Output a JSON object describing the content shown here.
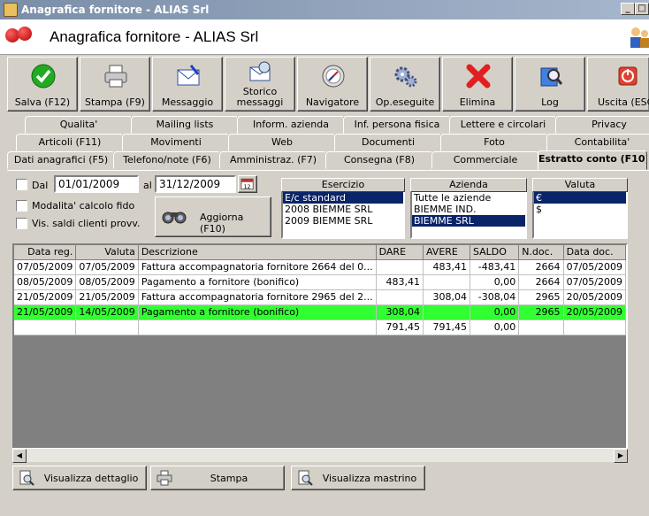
{
  "window": {
    "title": "Anagrafica fornitore - ALIAS Srl",
    "header_title": "Anagrafica fornitore - ALIAS Srl"
  },
  "toolbar": [
    {
      "label": "Salva (F12)",
      "icon": "save-icon"
    },
    {
      "label": "Stampa (F9)",
      "icon": "printer-icon"
    },
    {
      "label": "Messaggio",
      "icon": "message-icon"
    },
    {
      "label": "Storico messaggi",
      "icon": "message-history-icon"
    },
    {
      "label": "Navigatore",
      "icon": "compass-icon"
    },
    {
      "label": "Op.eseguite",
      "icon": "gears-icon"
    },
    {
      "label": "Elimina",
      "icon": "delete-icon"
    },
    {
      "label": "Log",
      "icon": "log-icon"
    },
    {
      "label": "Uscita (ESC)",
      "icon": "exit-icon"
    }
  ],
  "tabs": {
    "row1": [
      "Qualita'",
      "Mailing lists",
      "Inform. azienda",
      "Inf. persona fisica",
      "Lettere e circolari",
      "Privacy"
    ],
    "row2": [
      "Articoli (F11)",
      "Movimenti",
      "Web",
      "Documenti",
      "Foto",
      "Contabilita'"
    ],
    "row3": [
      "Dati anagrafici (F5)",
      "Telefono/note (F6)",
      "Amministraz. (F7)",
      "Consegna (F8)",
      "Commerciale",
      "Estratto conto (F10)"
    ]
  },
  "filters": {
    "dal_label": "Dal",
    "al_label": "al",
    "dal_value": "01/01/2009",
    "al_value": "31/12/2009",
    "modalita_label": "Modalita' calcolo fido",
    "vis_saldi_label": "Vis. saldi clienti provv.",
    "aggiorna_label": "Aggiorna (F10)"
  },
  "esercizio": {
    "header": "Esercizio",
    "items": [
      "E/c standard",
      "2008 BIEMME SRL",
      "2009 BIEMME SRL"
    ],
    "selected": 0
  },
  "azienda": {
    "header": "Azienda",
    "items": [
      "Tutte le aziende",
      "BIEMME IND.",
      "BIEMME SRL"
    ],
    "selected": 2
  },
  "valuta": {
    "header": "Valuta",
    "items": [
      "€",
      "$"
    ],
    "selected": 0
  },
  "grid": {
    "columns": [
      "Data reg.",
      "Valuta",
      "Descrizione",
      "DARE",
      "AVERE",
      "SALDO",
      "N.doc.",
      "Data doc."
    ],
    "rows": [
      [
        "07/05/2009",
        "07/05/2009",
        "Fattura accompagnatoria fornitore 2664 del 0...",
        "",
        "483,41",
        "-483,41",
        "2664",
        "07/05/2009"
      ],
      [
        "08/05/2009",
        "08/05/2009",
        "Pagamento a fornitore (bonifico)",
        "483,41",
        "",
        "0,00",
        "2664",
        "07/05/2009"
      ],
      [
        "21/05/2009",
        "21/05/2009",
        "Fattura accompagnatoria fornitore 2965 del 2...",
        "",
        "308,04",
        "-308,04",
        "2965",
        "20/05/2009"
      ],
      [
        "21/05/2009",
        "14/05/2009",
        "Pagamento a fornitore (bonifico)",
        "308,04",
        "",
        "0,00",
        "2965",
        "20/05/2009"
      ]
    ],
    "totals": [
      "",
      "",
      "",
      "791,45",
      "791,45",
      "0,00",
      "",
      ""
    ],
    "highlight_row": 3,
    "highlight_color": "#32ff32"
  },
  "bottom_buttons": [
    "Visualizza dettaglio",
    "Stampa",
    "Visualizza mastrino"
  ]
}
